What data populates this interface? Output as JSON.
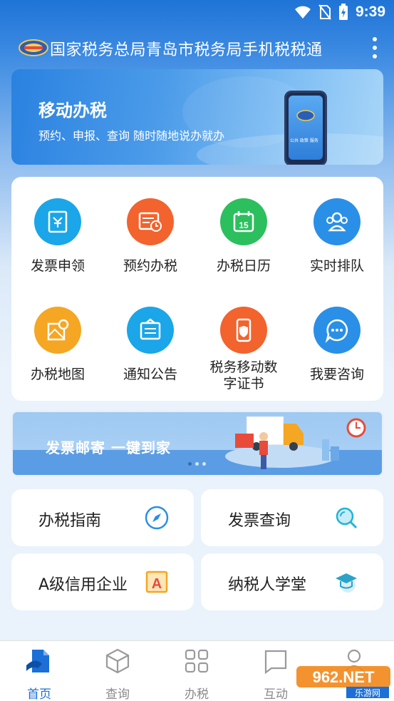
{
  "status_bar": {
    "time": "9:39"
  },
  "app_bar": {
    "title": "国家税务总局青岛市税务局手机税税通"
  },
  "banner": {
    "title": "移动办税",
    "subtitle": "预约、申报、查询 随时随地说办就办",
    "phone_caption": "公共 政策 服务"
  },
  "services": [
    {
      "label": "发票申领",
      "icon": "invoice-icon",
      "color": "#1aa6e8"
    },
    {
      "label": "预约办税",
      "icon": "appointment-icon",
      "color": "#f2632d"
    },
    {
      "label": "办税日历",
      "icon": "calendar-icon",
      "color": "#2cbf5e"
    },
    {
      "label": "实时排队",
      "icon": "queue-icon",
      "color": "#2a8fe6"
    },
    {
      "label": "办税地图",
      "icon": "map-icon",
      "color": "#f5a623"
    },
    {
      "label": "通知公告",
      "icon": "notice-icon",
      "color": "#1aa6e8"
    },
    {
      "label": "税务移动数\n字证书",
      "icon": "certificate-icon",
      "color": "#f2632d"
    },
    {
      "label": "我要咨询",
      "icon": "consult-icon",
      "color": "#2a8fe6"
    }
  ],
  "calendar_day": "15",
  "promo": {
    "text": "发票邮寄  一键到家",
    "active_dot": 0
  },
  "tiles": [
    {
      "label": "办税指南",
      "icon": "compass-icon"
    },
    {
      "label": "发票查询",
      "icon": "magnifier-icon"
    },
    {
      "label": "A级信用企业",
      "icon": "credit-a-icon"
    },
    {
      "label": "纳税人学堂",
      "icon": "graduation-cap-icon"
    }
  ],
  "nav": [
    {
      "label": "首页",
      "active": true
    },
    {
      "label": "查询",
      "active": false
    },
    {
      "label": "办税",
      "active": false
    },
    {
      "label": "互动",
      "active": false
    }
  ],
  "watermark": {
    "text": "962.NET",
    "sub": "乐游网"
  },
  "colors": {
    "brand": "#1b6fd6",
    "nav_inactive": "#8a8a8a"
  }
}
